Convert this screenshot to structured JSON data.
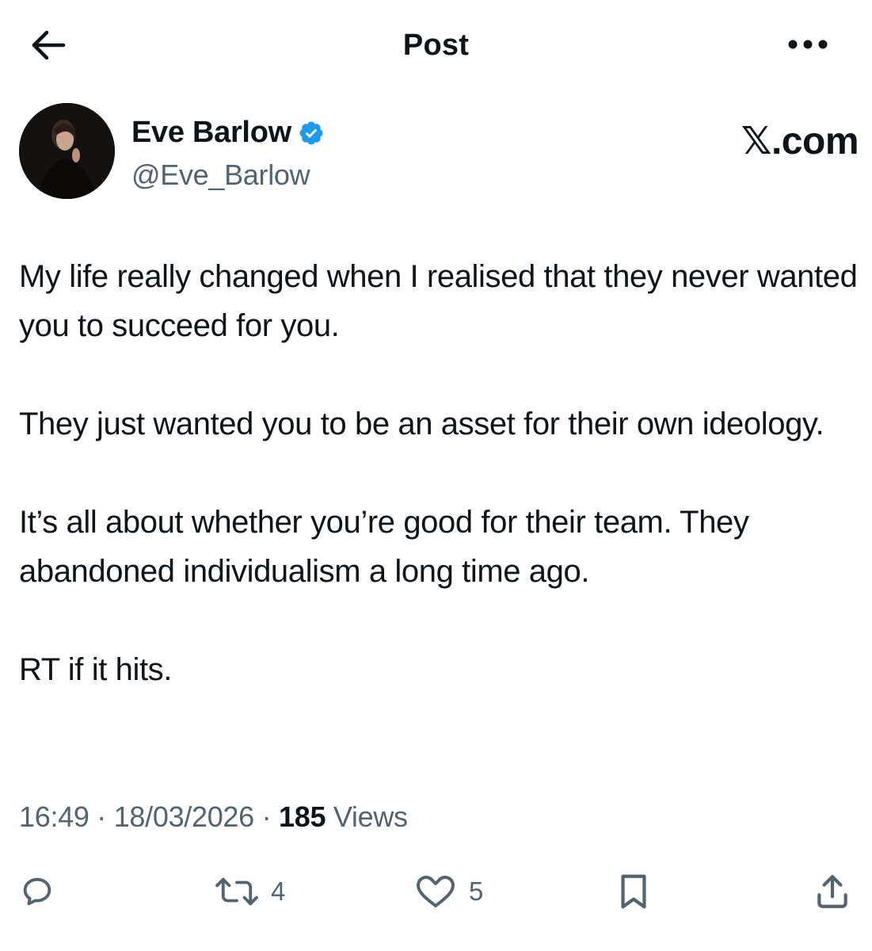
{
  "header": {
    "title": "Post",
    "back_icon": "arrow-left-icon",
    "more_icon": "more-horizontal-icon"
  },
  "author": {
    "display_name": "Eve Barlow",
    "handle": "@Eve_Barlow",
    "verified": true,
    "verified_color": "#1d9bf0"
  },
  "brand": {
    "label": "𝕏.com"
  },
  "post": {
    "paragraphs": [
      "My life really changed when I realised that they never wanted you to succeed for you.",
      "They just wanted you to be an asset for their own ideology.",
      "It’s all about whether you’re good for their team. They abandoned individualism a long time ago.",
      "RT if it hits."
    ]
  },
  "meta": {
    "time": "16:49",
    "separator": "·",
    "date": "18/03/2026",
    "views_count": "185",
    "views_label": "Views"
  },
  "actions": {
    "reply": {
      "icon": "reply-icon",
      "count": ""
    },
    "repost": {
      "icon": "repost-icon",
      "count": "4"
    },
    "like": {
      "icon": "heart-icon",
      "count": "5"
    },
    "bookmark": {
      "icon": "bookmark-icon",
      "count": ""
    },
    "share": {
      "icon": "share-icon",
      "count": ""
    }
  },
  "colors": {
    "text_primary": "#0f1419",
    "text_secondary": "#536471",
    "accent": "#1d9bf0",
    "background": "#ffffff"
  }
}
